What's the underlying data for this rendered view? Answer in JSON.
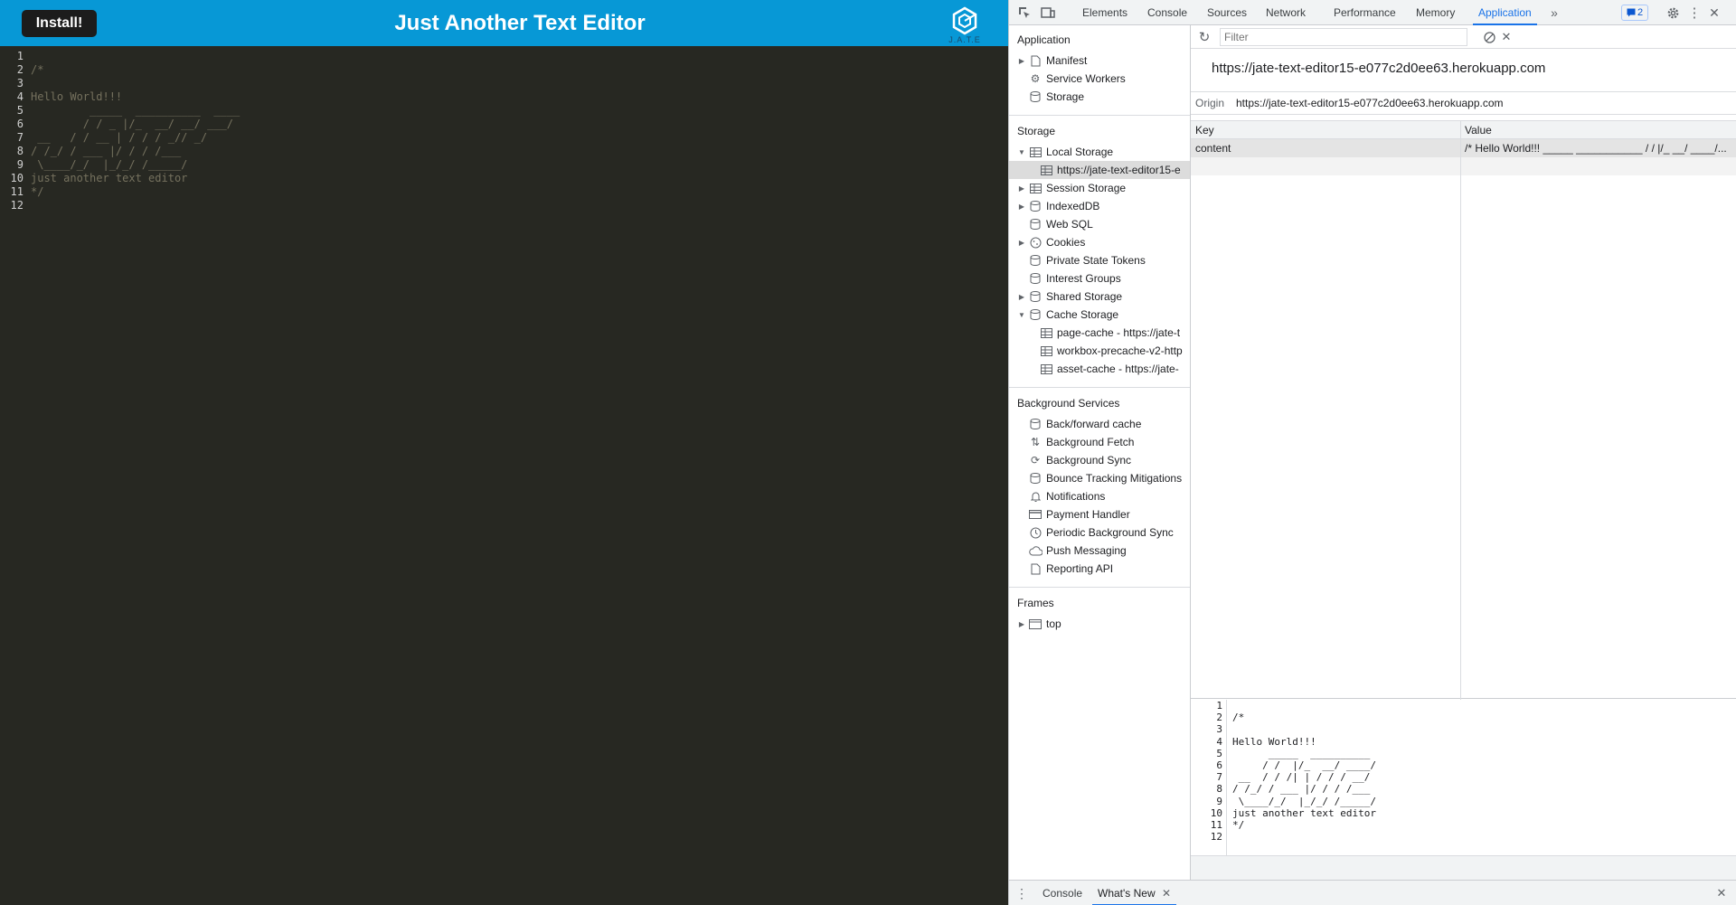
{
  "app": {
    "install_label": "Install!",
    "title": "Just Another Text Editor",
    "logo_text": "J.A.T.E",
    "editor_lines": [
      "",
      "/*",
      "",
      "Hello World!!!",
      "         _____  __________  ____",
      "        / / _ |/_  __/ __/ ___/",
      " __   / / __ | / / / _// _/",
      "/ /_/ / ___ |/ / / /___",
      " \\____/_/  |_/_/ /_____/",
      "just another text editor",
      "*/",
      ""
    ],
    "line_numbers": [
      "1",
      "2",
      "3",
      "4",
      "5",
      "6",
      "7",
      "8",
      "9",
      "10",
      "11",
      "12"
    ]
  },
  "devtools": {
    "tabs": [
      "Elements",
      "Console",
      "Sources",
      "Network",
      "Performance",
      "Memory",
      "Application"
    ],
    "active_tab": "Application",
    "issues_count": "2",
    "sidebar": {
      "application_title": "Application",
      "application_items": [
        "Manifest",
        "Service Workers",
        "Storage"
      ],
      "storage_title": "Storage",
      "storage_items": {
        "local_storage": "Local Storage",
        "local_storage_child": "https://jate-text-editor15-e",
        "session_storage": "Session Storage",
        "indexeddb": "IndexedDB",
        "web_sql": "Web SQL",
        "cookies": "Cookies",
        "private_state_tokens": "Private State Tokens",
        "interest_groups": "Interest Groups",
        "shared_storage": "Shared Storage",
        "cache_storage": "Cache Storage",
        "cache_children": [
          "page-cache - https://jate-t",
          "workbox-precache-v2-http",
          "asset-cache - https://jate-"
        ]
      },
      "background_title": "Background Services",
      "background_items": [
        "Back/forward cache",
        "Background Fetch",
        "Background Sync",
        "Bounce Tracking Mitigations",
        "Notifications",
        "Payment Handler",
        "Periodic Background Sync",
        "Push Messaging",
        "Reporting API"
      ],
      "frames_title": "Frames",
      "frames_items": [
        "top"
      ]
    },
    "main": {
      "filter_placeholder": "Filter",
      "origin_title": "https://jate-text-editor15-e077c2d0ee63.herokuapp.com",
      "origin_label": "Origin",
      "origin_value": "https://jate-text-editor15-e077c2d0ee63.herokuapp.com",
      "columns": [
        "Key",
        "Value"
      ],
      "rows": [
        {
          "key": "content",
          "value": "/* Hello World!!! _____ ___________ / / |/_ __/ ____/..."
        }
      ],
      "preview_lines": [
        "",
        "/*",
        "",
        "Hello World!!!",
        "      _____  __________",
        "     / /  |/_  __/ ____/",
        " __  / / /| | / / / __/",
        "/ /_/ / ___ |/ / / /___",
        " \\____/_/  |_/_/ /_____/",
        "just another text editor",
        "*/",
        ""
      ]
    },
    "drawer": {
      "tabs": [
        "Console",
        "What's New"
      ],
      "active": "What's New"
    }
  }
}
